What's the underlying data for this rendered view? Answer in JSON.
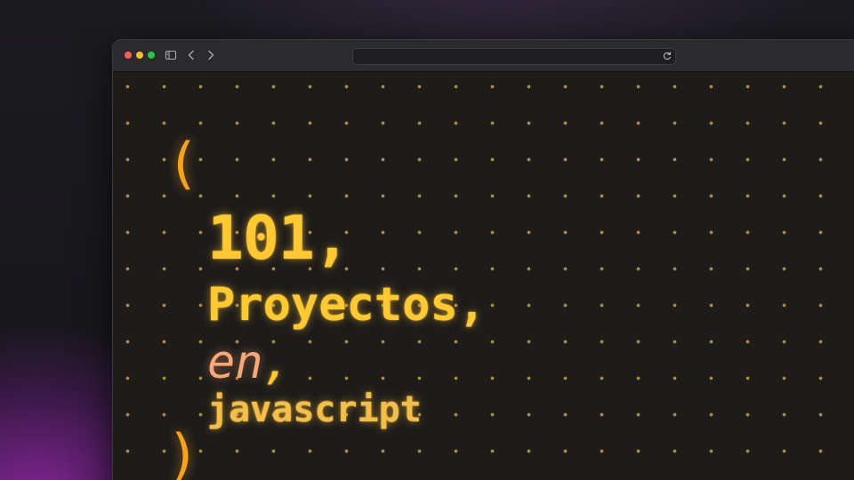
{
  "toolbar": {
    "icons": {
      "sidebar": "sidebar-toggle-icon",
      "back": "chevron-left-icon",
      "forward": "chevron-right-icon",
      "reload": "reload-icon"
    },
    "address_value": ""
  },
  "hero": {
    "open_paren": "(",
    "number": "101,",
    "word1": "Proyectos,",
    "word2": "en",
    "comma2": ",",
    "word3": "javascript",
    "close_paren": ")"
  },
  "colors": {
    "accent": "#ffc934",
    "paren": "#f9a318",
    "italic_word": "#f5a978",
    "dots": "#a98a46"
  }
}
